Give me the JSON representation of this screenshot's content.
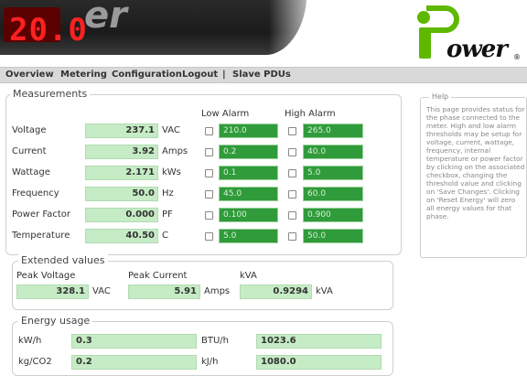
{
  "header": {
    "lcd_display": "20.0",
    "device_brand_partial": "er",
    "logo_text": "ower",
    "logo_reg": "®"
  },
  "nav": {
    "items": [
      "Overview",
      "Metering",
      "Configuration",
      "Logout",
      "|",
      "Slave PDUs"
    ]
  },
  "measurements": {
    "legend": "Measurements",
    "low_alarm_header": "Low Alarm",
    "high_alarm_header": "High Alarm",
    "rows": [
      {
        "label": "Voltage",
        "value": "237.1",
        "unit": "VAC",
        "low": "210.0",
        "high": "265.0"
      },
      {
        "label": "Current",
        "value": "3.92",
        "unit": "Amps",
        "low": "0.2",
        "high": "40.0"
      },
      {
        "label": "Wattage",
        "value": "2.171",
        "unit": "kWs",
        "low": "0.1",
        "high": "5.0"
      },
      {
        "label": "Frequency",
        "value": "50.0",
        "unit": "Hz",
        "low": "45.0",
        "high": "60.0"
      },
      {
        "label": "Power Factor",
        "value": "0.000",
        "unit": "PF",
        "low": "0.100",
        "high": "0.900"
      },
      {
        "label": "Temperature",
        "value": "40.50",
        "unit": "C",
        "low": "5.0",
        "high": "50.0"
      }
    ]
  },
  "extended": {
    "legend": "Extended values",
    "peak_voltage_label": "Peak Voltage",
    "peak_voltage_value": "328.1",
    "peak_voltage_unit": "VAC",
    "peak_current_label": "Peak Current",
    "peak_current_value": "5.91",
    "peak_current_unit": "Amps",
    "kva_label": "kVA",
    "kva_value": "0.9294",
    "kva_unit": "kVA"
  },
  "energy": {
    "legend": "Energy usage",
    "kwh_label": "kW/h",
    "kwh_value": "0.3",
    "btuh_label": "BTU/h",
    "btuh_value": "1023.6",
    "kgco2_label": "kg/CO2",
    "kgco2_value": "0.2",
    "kjh_label": "kJ/h",
    "kjh_value": "1080.0"
  },
  "help": {
    "legend": "Help",
    "text": "This page provides status for the phase connected to the meter. High and low alarm thresholds may be setup for voltage, current, wattage, frequency, internal temperature or power factor by clicking on the associated checkbox, changing the threshold value and clicking on 'Save Changes'. Clicking on 'Reset Energy' will zero all energy values for that phase."
  },
  "colors": {
    "value_bg": "#c5ecc5",
    "alarm_bg": "#2f9b3a",
    "logo_green": "#5fb800",
    "nav_bg": "#d9d9d9"
  }
}
